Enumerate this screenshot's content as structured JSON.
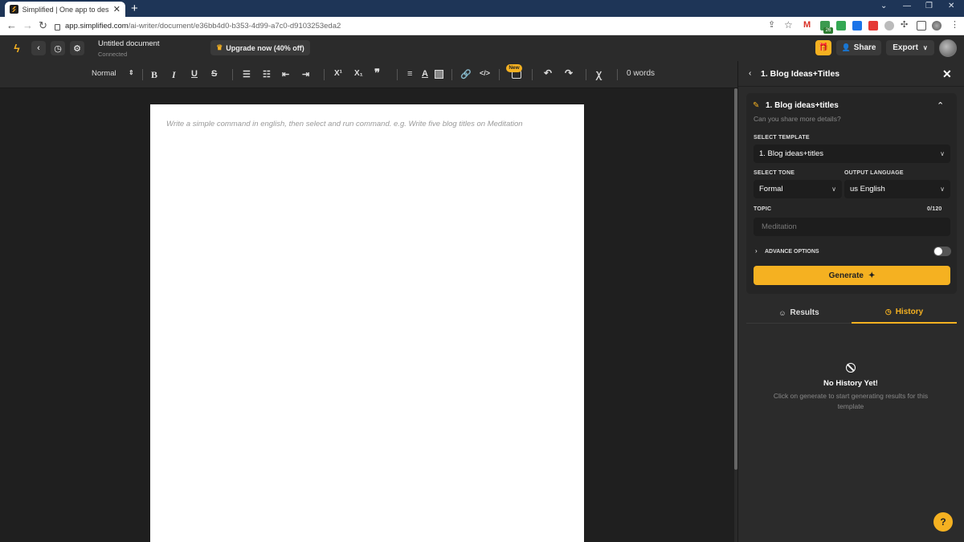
{
  "browser": {
    "tab_title": "Simplified | One app to design, c",
    "url_domain": "app.simplified.com",
    "url_path": "/ai-writer/document/e36bb4d0-b353-4d99-a7c0-d9103253eda2",
    "ext_badge": "26"
  },
  "header": {
    "doc_title": "Untitled document",
    "doc_status": "Connected",
    "upgrade_label": "Upgrade now (40% off)",
    "share_label": "Share",
    "export_label": "Export"
  },
  "toolbar": {
    "style_select": "Normal",
    "bold": "B",
    "italic": "I",
    "underline": "U",
    "strike": "S",
    "superscript": "X¹",
    "subscript": "X₁",
    "quote": "❞",
    "new_badge": "New",
    "word_count": "0 words"
  },
  "editor": {
    "placeholder": "Write a simple command in english, then select and run command. e.g. Write five blog titles on Meditation"
  },
  "panel": {
    "title": "1. Blog Ideas+Titles",
    "card_title": "1. Blog ideas+titles",
    "card_subtitle": "Can you share more details?",
    "template_label": "SELECT TEMPLATE",
    "template_value": "1. Blog ideas+titles",
    "tone_label": "SELECT TONE",
    "tone_value": "Formal",
    "language_label": "OUTPUT LANGUAGE",
    "language_value": "us English",
    "topic_label": "TOPIC",
    "topic_count": "0/120",
    "topic_placeholder": "Meditation",
    "advance_label": "ADVANCE OPTIONS",
    "generate_label": "Generate",
    "tab_results": "Results",
    "tab_history": "History",
    "empty_title": "No History Yet!",
    "empty_desc": "Click on generate to start generating results for this template"
  },
  "colors": {
    "accent": "#f5b121",
    "panel_bg": "#2b2b2b",
    "editor_bg": "#1f1f1f"
  }
}
